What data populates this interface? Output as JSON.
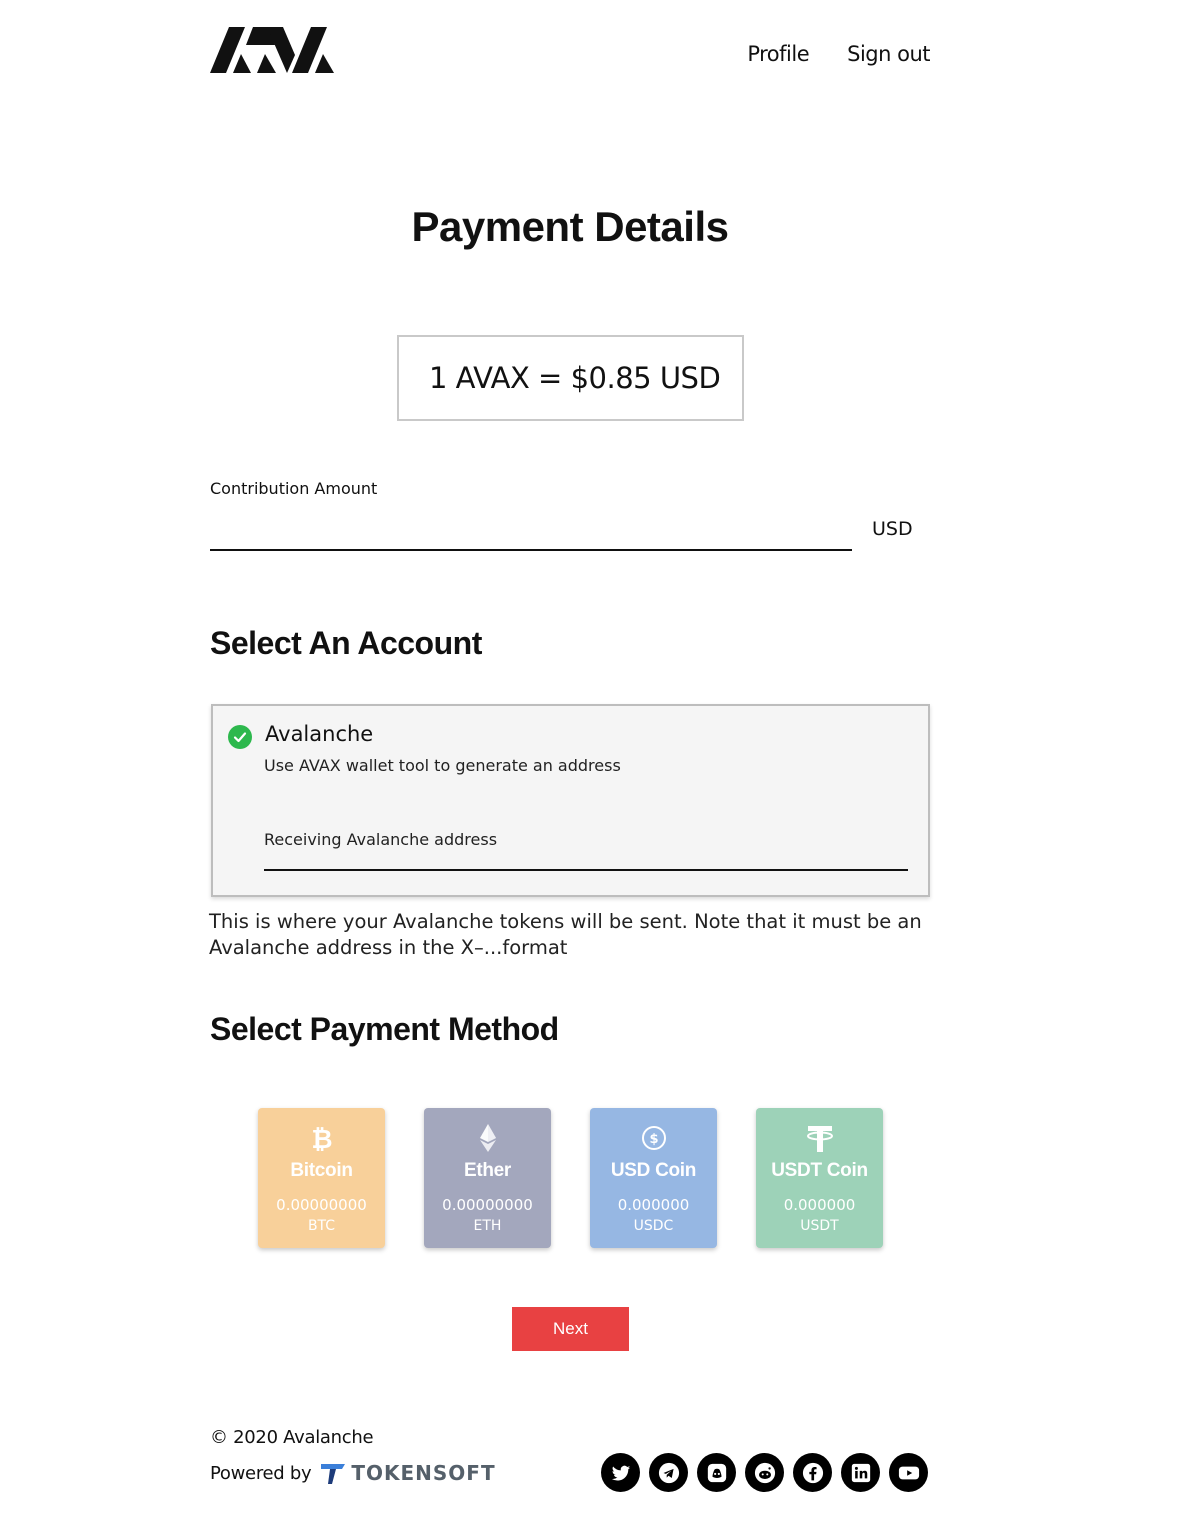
{
  "header": {
    "logo_alt": "AVA",
    "nav": [
      {
        "label": "Profile"
      },
      {
        "label": "Sign out"
      }
    ]
  },
  "page_title": "Payment Details",
  "rate": "1 AVAX = $0.85 USD",
  "contribution": {
    "label": "Contribution Amount",
    "value": "",
    "unit": "USD"
  },
  "account_section": {
    "title": "Select An Account",
    "card": {
      "name": "Avalanche",
      "description": "Use AVAX wallet tool to generate an address",
      "address_label": "Receiving Avalanche address",
      "address_value": ""
    },
    "helper": "This is where your Avalanche tokens will be sent. Note that it must be an Avalanche address in the X–...format"
  },
  "payment_section": {
    "title": "Select Payment Method",
    "methods": [
      {
        "name": "Bitcoin",
        "balance": "0.00000000",
        "unit": "BTC",
        "color": "#f8d09a",
        "icon": "bitcoin-icon"
      },
      {
        "name": "Ether",
        "balance": "0.00000000",
        "unit": "ETH",
        "color": "#a3a7bd",
        "icon": "ethereum-icon"
      },
      {
        "name": "USD Coin",
        "balance": "0.000000",
        "unit": "USDC",
        "color": "#96b7e3",
        "icon": "usd-coin-icon"
      },
      {
        "name": "USDT Coin",
        "balance": "0.000000",
        "unit": "USDT",
        "color": "#9dd2b8",
        "icon": "tether-icon"
      }
    ]
  },
  "next_label": "Next",
  "footer": {
    "copyright": "© 2020 Avalanche",
    "powered_by": "Powered by",
    "powered_brand": "TOKENSOFT",
    "socials": [
      "twitter-icon",
      "telegram-icon",
      "discord-icon",
      "reddit-icon",
      "facebook-icon",
      "linkedin-icon",
      "youtube-icon"
    ]
  },
  "colors": {
    "accent": "#e84142",
    "check": "#2db84d"
  }
}
